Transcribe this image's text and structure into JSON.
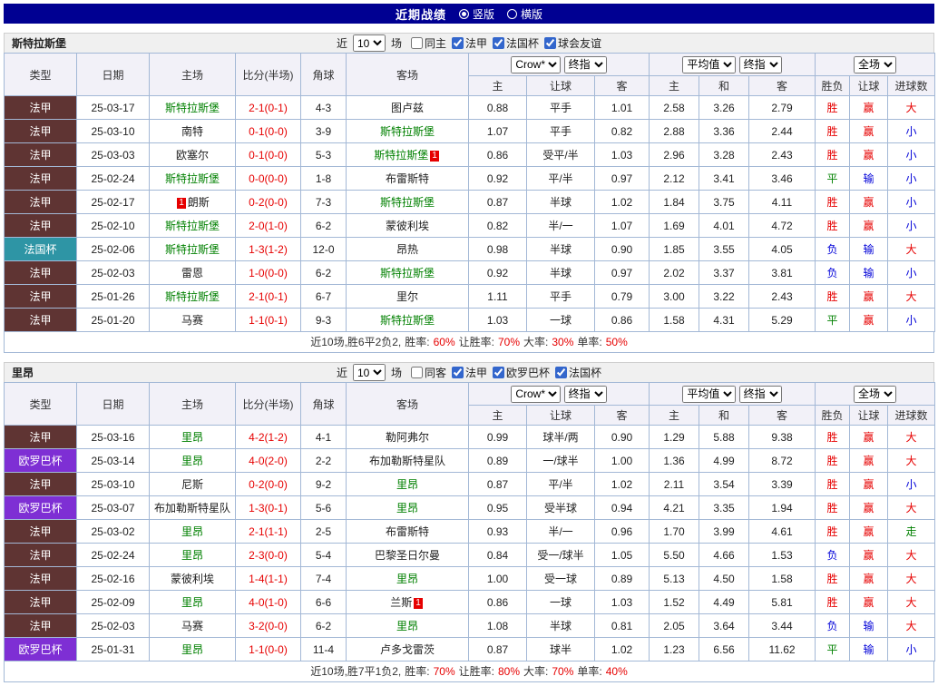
{
  "header": {
    "title": "近期战绩",
    "layout_options": [
      {
        "label": "竖版",
        "selected": true
      },
      {
        "label": "横版",
        "selected": false
      }
    ]
  },
  "filter_labels": {
    "near": "近",
    "games": "场"
  },
  "columns": {
    "type": "类型",
    "date": "日期",
    "home": "主场",
    "score": "比分(半场)",
    "corner": "角球",
    "away": "客场",
    "o_home": "主",
    "o_handicap": "让球",
    "o_away": "客",
    "a_home": "主",
    "a_draw": "和",
    "a_away": "客",
    "r_wdl": "胜负",
    "r_handicap": "让球",
    "r_goals": "进球数"
  },
  "selects": {
    "provider": "Crow*",
    "final": "终指",
    "average": "平均值",
    "fulltime": "全场"
  },
  "league_colors": {
    "法甲": "#5f3433",
    "法国杯": "#2e95a5",
    "欧罗巴杯": "#7e2fd4"
  },
  "team_highlight_color": "#008000",
  "result_colors": {
    "red": "#e60000",
    "blue": "#0000d8",
    "green": "#008000"
  },
  "sections": [
    {
      "team": "斯特拉斯堡",
      "filter": {
        "count": "10",
        "checkboxes": [
          {
            "label": "同主",
            "checked": false
          },
          {
            "label": "法甲",
            "checked": true
          },
          {
            "label": "法国杯",
            "checked": true
          },
          {
            "label": "球会友谊",
            "checked": true
          }
        ]
      },
      "rows": [
        {
          "league": "法甲",
          "date": "25-03-17",
          "home": "斯特拉斯堡",
          "home_green": true,
          "score": "2-1(0-1)",
          "corners": "4-3",
          "away": "图卢兹",
          "odds": [
            "0.88",
            "平手",
            "1.01"
          ],
          "avg": [
            "2.58",
            "3.26",
            "2.79"
          ],
          "results": [
            {
              "t": "胜",
              "c": "red"
            },
            {
              "t": "赢",
              "c": "red"
            },
            {
              "t": "大",
              "c": "red"
            }
          ]
        },
        {
          "league": "法甲",
          "date": "25-03-10",
          "home": "南特",
          "score": "0-1(0-0)",
          "corners": "3-9",
          "away": "斯特拉斯堡",
          "away_green": true,
          "odds": [
            "1.07",
            "平手",
            "0.82"
          ],
          "avg": [
            "2.88",
            "3.36",
            "2.44"
          ],
          "results": [
            {
              "t": "胜",
              "c": "red"
            },
            {
              "t": "赢",
              "c": "red"
            },
            {
              "t": "小",
              "c": "blue"
            }
          ]
        },
        {
          "league": "法甲",
          "date": "25-03-03",
          "home": "欧塞尔",
          "score": "0-1(0-0)",
          "corners": "5-3",
          "away": "斯特拉斯堡",
          "away_green": true,
          "away_card": {
            "n": "1",
            "pos": "after"
          },
          "odds": [
            "0.86",
            "受平/半",
            "1.03"
          ],
          "avg": [
            "2.96",
            "3.28",
            "2.43"
          ],
          "results": [
            {
              "t": "胜",
              "c": "red"
            },
            {
              "t": "赢",
              "c": "red"
            },
            {
              "t": "小",
              "c": "blue"
            }
          ]
        },
        {
          "league": "法甲",
          "date": "25-02-24",
          "home": "斯特拉斯堡",
          "home_green": true,
          "score": "0-0(0-0)",
          "corners": "1-8",
          "away": "布雷斯特",
          "odds": [
            "0.92",
            "平/半",
            "0.97"
          ],
          "avg": [
            "2.12",
            "3.41",
            "3.46"
          ],
          "results": [
            {
              "t": "平",
              "c": "green"
            },
            {
              "t": "输",
              "c": "blue"
            },
            {
              "t": "小",
              "c": "blue"
            }
          ]
        },
        {
          "league": "法甲",
          "date": "25-02-17",
          "home": "朗斯",
          "home_card": {
            "n": "1",
            "pos": "before"
          },
          "score": "0-2(0-0)",
          "corners": "7-3",
          "away": "斯特拉斯堡",
          "away_green": true,
          "odds": [
            "0.87",
            "半球",
            "1.02"
          ],
          "avg": [
            "1.84",
            "3.75",
            "4.11"
          ],
          "results": [
            {
              "t": "胜",
              "c": "red"
            },
            {
              "t": "赢",
              "c": "red"
            },
            {
              "t": "小",
              "c": "blue"
            }
          ]
        },
        {
          "league": "法甲",
          "date": "25-02-10",
          "home": "斯特拉斯堡",
          "home_green": true,
          "score": "2-0(1-0)",
          "corners": "6-2",
          "away": "蒙彼利埃",
          "odds": [
            "0.82",
            "半/一",
            "1.07"
          ],
          "avg": [
            "1.69",
            "4.01",
            "4.72"
          ],
          "results": [
            {
              "t": "胜",
              "c": "red"
            },
            {
              "t": "赢",
              "c": "red"
            },
            {
              "t": "小",
              "c": "blue"
            }
          ]
        },
        {
          "league": "法国杯",
          "date": "25-02-06",
          "home": "斯特拉斯堡",
          "home_green": true,
          "score": "1-3(1-2)",
          "corners": "12-0",
          "away": "昂热",
          "odds": [
            "0.98",
            "半球",
            "0.90"
          ],
          "avg": [
            "1.85",
            "3.55",
            "4.05"
          ],
          "results": [
            {
              "t": "负",
              "c": "blue"
            },
            {
              "t": "输",
              "c": "blue"
            },
            {
              "t": "大",
              "c": "red"
            }
          ]
        },
        {
          "league": "法甲",
          "date": "25-02-03",
          "home": "雷恩",
          "score": "1-0(0-0)",
          "corners": "6-2",
          "away": "斯特拉斯堡",
          "away_green": true,
          "odds": [
            "0.92",
            "半球",
            "0.97"
          ],
          "avg": [
            "2.02",
            "3.37",
            "3.81"
          ],
          "results": [
            {
              "t": "负",
              "c": "blue"
            },
            {
              "t": "输",
              "c": "blue"
            },
            {
              "t": "小",
              "c": "blue"
            }
          ]
        },
        {
          "league": "法甲",
          "date": "25-01-26",
          "home": "斯特拉斯堡",
          "home_green": true,
          "score": "2-1(0-1)",
          "corners": "6-7",
          "away": "里尔",
          "odds": [
            "1.11",
            "平手",
            "0.79"
          ],
          "avg": [
            "3.00",
            "3.22",
            "2.43"
          ],
          "results": [
            {
              "t": "胜",
              "c": "red"
            },
            {
              "t": "赢",
              "c": "red"
            },
            {
              "t": "大",
              "c": "red"
            }
          ]
        },
        {
          "league": "法甲",
          "date": "25-01-20",
          "home": "马赛",
          "score": "1-1(0-1)",
          "corners": "9-3",
          "away": "斯特拉斯堡",
          "away_green": true,
          "odds": [
            "1.03",
            "一球",
            "0.86"
          ],
          "avg": [
            "1.58",
            "4.31",
            "5.29"
          ],
          "results": [
            {
              "t": "平",
              "c": "green"
            },
            {
              "t": "赢",
              "c": "red"
            },
            {
              "t": "小",
              "c": "blue"
            }
          ]
        }
      ],
      "summary": {
        "prefix": "近10场,胜6平2负2,",
        "stats": [
          {
            "label": "胜率:",
            "value": "60%"
          },
          {
            "label": "让胜率:",
            "value": "70%"
          },
          {
            "label": "大率:",
            "value": "30%"
          },
          {
            "label": "单率:",
            "value": "50%"
          }
        ]
      }
    },
    {
      "team": "里昂",
      "filter": {
        "count": "10",
        "checkboxes": [
          {
            "label": "同客",
            "checked": false
          },
          {
            "label": "法甲",
            "checked": true
          },
          {
            "label": "欧罗巴杯",
            "checked": true
          },
          {
            "label": "法国杯",
            "checked": true
          }
        ]
      },
      "rows": [
        {
          "league": "法甲",
          "date": "25-03-16",
          "home": "里昂",
          "home_green": true,
          "score": "4-2(1-2)",
          "corners": "4-1",
          "away": "勒阿弗尔",
          "odds": [
            "0.99",
            "球半/两",
            "0.90"
          ],
          "avg": [
            "1.29",
            "5.88",
            "9.38"
          ],
          "results": [
            {
              "t": "胜",
              "c": "red"
            },
            {
              "t": "赢",
              "c": "red"
            },
            {
              "t": "大",
              "c": "red"
            }
          ]
        },
        {
          "league": "欧罗巴杯",
          "date": "25-03-14",
          "home": "里昂",
          "home_green": true,
          "score": "4-0(2-0)",
          "corners": "2-2",
          "away": "布加勒斯特星队",
          "odds": [
            "0.89",
            "一/球半",
            "1.00"
          ],
          "avg": [
            "1.36",
            "4.99",
            "8.72"
          ],
          "results": [
            {
              "t": "胜",
              "c": "red"
            },
            {
              "t": "赢",
              "c": "red"
            },
            {
              "t": "大",
              "c": "red"
            }
          ]
        },
        {
          "league": "法甲",
          "date": "25-03-10",
          "home": "尼斯",
          "score": "0-2(0-0)",
          "corners": "9-2",
          "away": "里昂",
          "away_green": true,
          "odds": [
            "0.87",
            "平/半",
            "1.02"
          ],
          "avg": [
            "2.11",
            "3.54",
            "3.39"
          ],
          "results": [
            {
              "t": "胜",
              "c": "red"
            },
            {
              "t": "赢",
              "c": "red"
            },
            {
              "t": "小",
              "c": "blue"
            }
          ]
        },
        {
          "league": "欧罗巴杯",
          "date": "25-03-07",
          "home": "布加勒斯特星队",
          "score": "1-3(0-1)",
          "corners": "5-6",
          "away": "里昂",
          "away_green": true,
          "odds": [
            "0.95",
            "受半球",
            "0.94"
          ],
          "avg": [
            "4.21",
            "3.35",
            "1.94"
          ],
          "results": [
            {
              "t": "胜",
              "c": "red"
            },
            {
              "t": "赢",
              "c": "red"
            },
            {
              "t": "大",
              "c": "red"
            }
          ]
        },
        {
          "league": "法甲",
          "date": "25-03-02",
          "home": "里昂",
          "home_green": true,
          "score": "2-1(1-1)",
          "corners": "2-5",
          "away": "布雷斯特",
          "odds": [
            "0.93",
            "半/一",
            "0.96"
          ],
          "avg": [
            "1.70",
            "3.99",
            "4.61"
          ],
          "results": [
            {
              "t": "胜",
              "c": "red"
            },
            {
              "t": "赢",
              "c": "red"
            },
            {
              "t": "走",
              "c": "green"
            }
          ]
        },
        {
          "league": "法甲",
          "date": "25-02-24",
          "home": "里昂",
          "home_green": true,
          "score": "2-3(0-0)",
          "corners": "5-4",
          "away": "巴黎圣日尔曼",
          "odds": [
            "0.84",
            "受一/球半",
            "1.05"
          ],
          "avg": [
            "5.50",
            "4.66",
            "1.53"
          ],
          "results": [
            {
              "t": "负",
              "c": "blue"
            },
            {
              "t": "赢",
              "c": "red"
            },
            {
              "t": "大",
              "c": "red"
            }
          ]
        },
        {
          "league": "法甲",
          "date": "25-02-16",
          "home": "蒙彼利埃",
          "score": "1-4(1-1)",
          "corners": "7-4",
          "away": "里昂",
          "away_green": true,
          "odds": [
            "1.00",
            "受一球",
            "0.89"
          ],
          "avg": [
            "5.13",
            "4.50",
            "1.58"
          ],
          "results": [
            {
              "t": "胜",
              "c": "red"
            },
            {
              "t": "赢",
              "c": "red"
            },
            {
              "t": "大",
              "c": "red"
            }
          ]
        },
        {
          "league": "法甲",
          "date": "25-02-09",
          "home": "里昂",
          "home_green": true,
          "score": "4-0(1-0)",
          "corners": "6-6",
          "away": "兰斯",
          "away_card": {
            "n": "1",
            "pos": "after"
          },
          "odds": [
            "0.86",
            "一球",
            "1.03"
          ],
          "avg": [
            "1.52",
            "4.49",
            "5.81"
          ],
          "results": [
            {
              "t": "胜",
              "c": "red"
            },
            {
              "t": "赢",
              "c": "red"
            },
            {
              "t": "大",
              "c": "red"
            }
          ]
        },
        {
          "league": "法甲",
          "date": "25-02-03",
          "home": "马赛",
          "score": "3-2(0-0)",
          "corners": "6-2",
          "away": "里昂",
          "away_green": true,
          "odds": [
            "1.08",
            "半球",
            "0.81"
          ],
          "avg": [
            "2.05",
            "3.64",
            "3.44"
          ],
          "results": [
            {
              "t": "负",
              "c": "blue"
            },
            {
              "t": "输",
              "c": "blue"
            },
            {
              "t": "大",
              "c": "red"
            }
          ]
        },
        {
          "league": "欧罗巴杯",
          "date": "25-01-31",
          "home": "里昂",
          "home_green": true,
          "score": "1-1(0-0)",
          "corners": "11-4",
          "away": "卢多戈雷茨",
          "odds": [
            "0.87",
            "球半",
            "1.02"
          ],
          "avg": [
            "1.23",
            "6.56",
            "11.62"
          ],
          "results": [
            {
              "t": "平",
              "c": "green"
            },
            {
              "t": "输",
              "c": "blue"
            },
            {
              "t": "小",
              "c": "blue"
            }
          ]
        }
      ],
      "summary": {
        "prefix": "近10场,胜7平1负2,",
        "stats": [
          {
            "label": "胜率:",
            "value": "70%"
          },
          {
            "label": "让胜率:",
            "value": "80%"
          },
          {
            "label": "大率:",
            "value": "70%"
          },
          {
            "label": "单率:",
            "value": "40%"
          }
        ]
      }
    }
  ]
}
